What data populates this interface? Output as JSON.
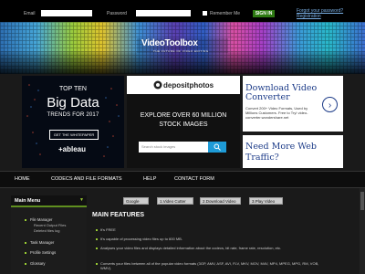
{
  "login": {
    "email_label": "Email",
    "password_label": "Password",
    "remember_label": "Remember Me",
    "signin_label": "SIGN IN",
    "forgot_label": "Forgot your password?",
    "register_label": "Registration"
  },
  "banner": {
    "logo": "VideoToolbox",
    "tagline": "THE FUTURE OF VIDEO EDITING"
  },
  "ads": {
    "tableau": {
      "top": "TOP TEN",
      "big": "Big Data",
      "sub": "TRENDS FOR 2017",
      "button": "GET THE WHITEPAPER",
      "brand": "+ableau"
    },
    "depositphotos": {
      "brand": "depositphotos",
      "line1": "EXPLORE OVER 60 MILLION",
      "line2": "STOCK IMAGES",
      "search_placeholder": "Search stock images"
    },
    "converter": {
      "title_1": "Download Video",
      "title_2": "Converter",
      "text": "Convert 200+ Video Formats, Used by Millions Customers. Free to Try! video-converter.wondershare.net"
    },
    "webtraffic": {
      "title_1": "Need More Web",
      "title_2": "Traffic?"
    }
  },
  "nav": {
    "items": [
      "HOME",
      "CODECS AND FILE FORMATS",
      "HELP",
      "CONTACT FORM"
    ]
  },
  "sidebar": {
    "title": "Main Menu",
    "items": [
      {
        "label": "File Manager",
        "children": [
          "Recent Output Files",
          "Deleted files log"
        ]
      },
      {
        "label": "Task Manager",
        "children": []
      },
      {
        "label": "Profile Settings",
        "children": []
      },
      {
        "label": "Glossary",
        "children": []
      }
    ]
  },
  "tabs": [
    "Google",
    "1.Video Cutter",
    "2.Download Video",
    "3.Play Video"
  ],
  "main": {
    "title": "MAIN FEATURES",
    "features": [
      "It's FREE",
      "It's capable of processing video files up to 600 MB.",
      "Analyses your video files and displays detailed information about the codecs, bit rate, frame rate, resolution, etc.",
      "Converts your files between all of the popular video formats (3GP, AMV, ASF, AVI, FLV, MKV, MOV, M4V, MP4, MPEG, MPG, RM, VOB, WMV)."
    ]
  },
  "colors": {
    "accent_green": "#5f8f1f",
    "signin_green": "#2d7a12",
    "link_blue": "#7ab0e6",
    "ad_blue": "#1c3b88"
  }
}
